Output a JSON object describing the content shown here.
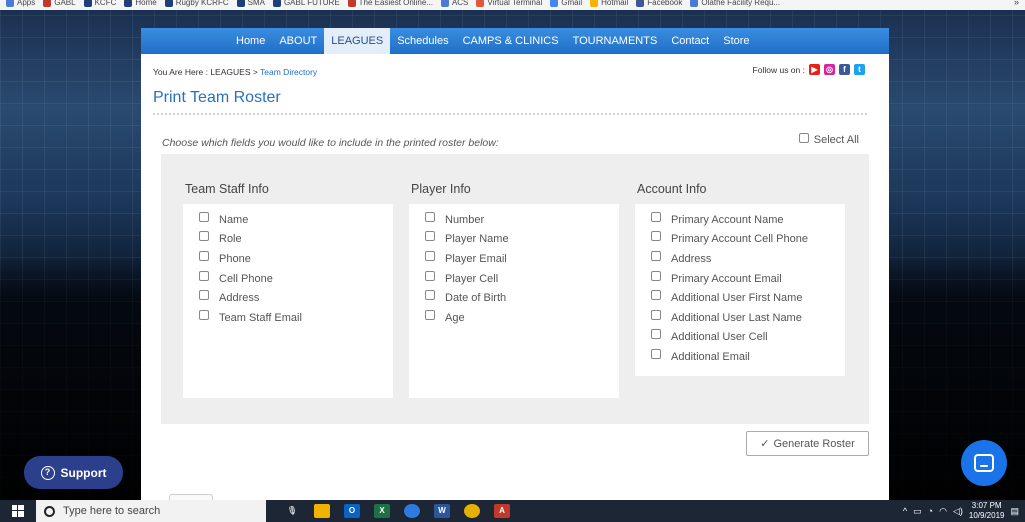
{
  "bookmarks": {
    "items": [
      {
        "label": "Apps",
        "color": "#4a7ad6"
      },
      {
        "label": "GABL",
        "color": "#c0392b"
      },
      {
        "label": "KCFC",
        "color": "#1f3f7a"
      },
      {
        "label": "Home",
        "color": "#1f3f7a"
      },
      {
        "label": "Rugby KCRFC",
        "color": "#1f3f7a"
      },
      {
        "label": "SMA",
        "color": "#1f3f7a"
      },
      {
        "label": "GABL FUTURE",
        "color": "#1f3f7a"
      },
      {
        "label": "The Easiest Online...",
        "color": "#c0392b"
      },
      {
        "label": "ACS",
        "color": "#4a7ad6"
      },
      {
        "label": "Virtual Terminal",
        "color": "#e0573a"
      },
      {
        "label": "Gmail",
        "color": "#4285f4"
      },
      {
        "label": "Hotmail",
        "color": "#f4b400"
      },
      {
        "label": "Facebook",
        "color": "#3b5998"
      },
      {
        "label": "Olathe Facility Requ...",
        "color": "#4a7ad6"
      }
    ],
    "more": "»"
  },
  "nav": {
    "items": [
      "Home",
      "ABOUT",
      "LEAGUES",
      "Schedules",
      "CAMPS & CLINICS",
      "TOURNAMENTS",
      "Contact",
      "Store"
    ],
    "active": "LEAGUES"
  },
  "breadcrumb": {
    "prefix": "You Are Here : LEAGUES > ",
    "current": "Team Directory"
  },
  "follow": {
    "label": "Follow us on :",
    "icons": [
      "youtube-icon",
      "instagram-icon",
      "facebook-icon",
      "twitter-icon"
    ]
  },
  "page": {
    "title": "Print Team Roster"
  },
  "instructions": "Choose which fields you would like to include in the printed roster below:",
  "select_all": "Select All",
  "columns": [
    {
      "title": "Team Staff Info",
      "options": [
        "Name",
        "Role",
        "Phone",
        "Cell Phone",
        "Address",
        "Team Staff Email"
      ]
    },
    {
      "title": "Player Info",
      "options": [
        "Number",
        "Player Name",
        "Player Email",
        "Player Cell",
        "Date of Birth",
        "Age"
      ]
    },
    {
      "title": "Account Info",
      "options": [
        "Primary Account Name",
        "Primary Account Cell Phone",
        "Address",
        "Primary Account Email",
        "Additional User First Name",
        "Additional User Last Name",
        "Additional User Cell",
        "Additional Email"
      ]
    }
  ],
  "generate_button": "Generate Roster",
  "support_button": "Support",
  "taskbar": {
    "search_placeholder": "Type here to search",
    "time": "3:07 PM",
    "date": "10/9/2019"
  },
  "colors": {
    "nav_blue": "#1f6fc7",
    "title_blue": "#2a6fbe",
    "support_bg": "#2b3f8c",
    "chat_bg": "#1a73e8"
  }
}
